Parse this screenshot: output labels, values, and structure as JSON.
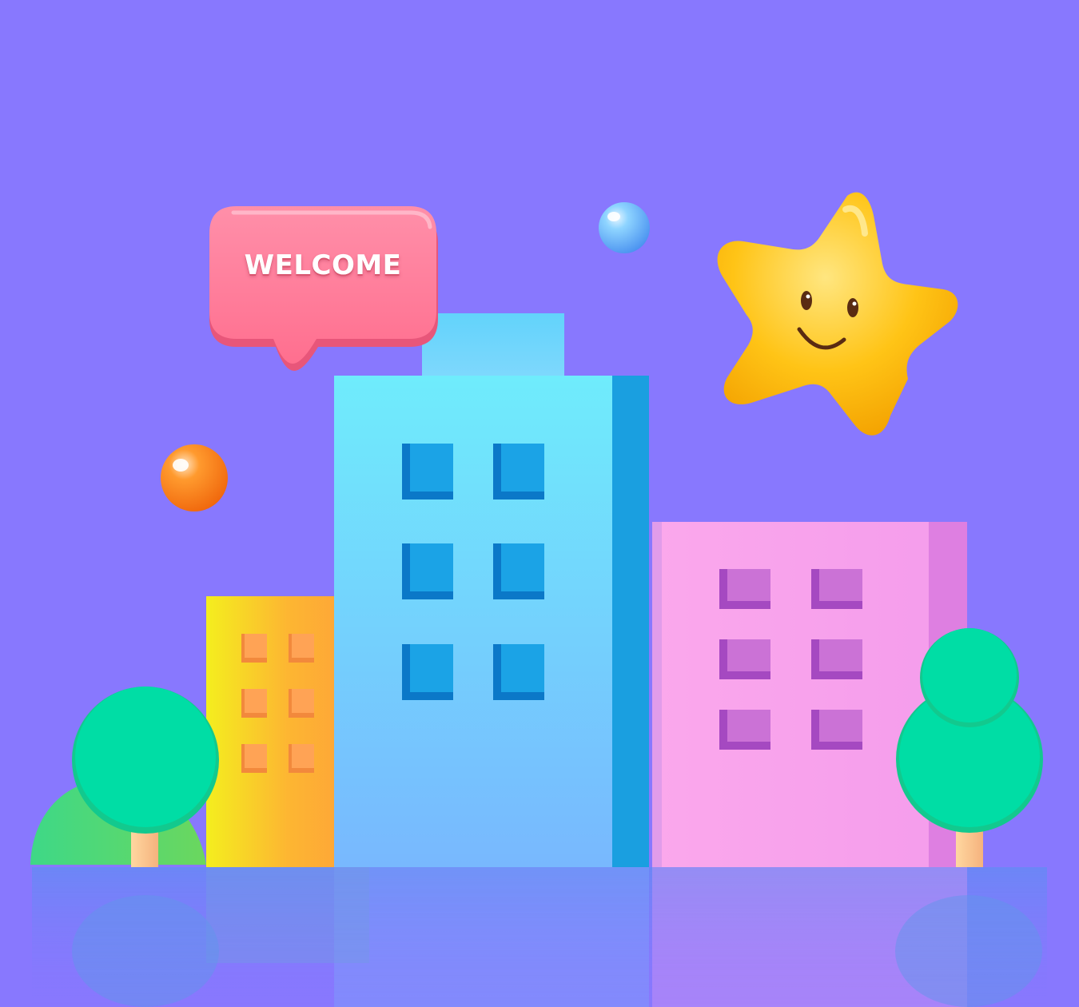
{
  "speech_bubble": {
    "text": "WELCOME"
  },
  "colors": {
    "background": "#8878FE",
    "bubble": "#FF7B9A",
    "tall_building": "#70E6FB",
    "left_building": "#F6E81E",
    "right_building": "#FBA8EC",
    "tree": "#00DDA5",
    "star": "#FFC413",
    "orb_blue": "#6FC2FF",
    "orb_orange": "#FF8A1E"
  },
  "icons": {
    "star": "smiling-star-icon",
    "tree": "tree-icon",
    "speech_bubble": "speech-bubble-icon",
    "orb": "sphere-icon"
  }
}
